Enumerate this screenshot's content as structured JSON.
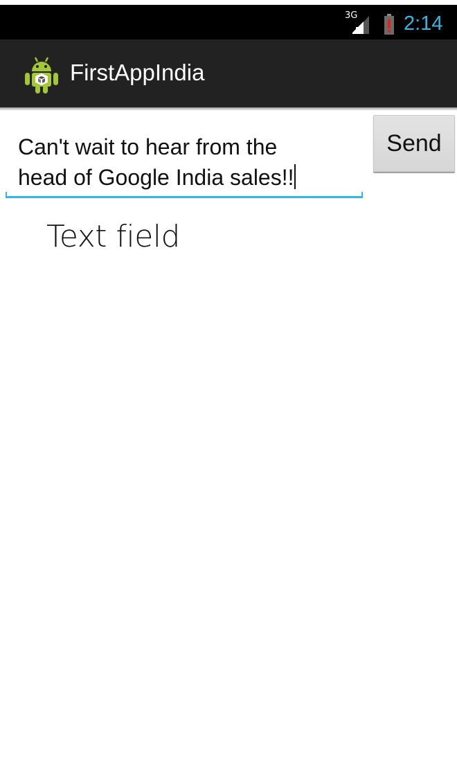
{
  "status_bar": {
    "network_type": "3G",
    "time": "2:14",
    "clock_color": "#33b5e5",
    "icons": [
      "signal-icon",
      "battery-low-icon"
    ]
  },
  "action_bar": {
    "icon": "android-app-icon",
    "title": "FirstAppIndia",
    "background": "#222222"
  },
  "compose": {
    "message_line_1": "Can't wait to hear from the",
    "message_line_2": "head of Google India sales!!",
    "underline_color": "#33b5e5",
    "send_label": "Send"
  },
  "annotation": {
    "label": "Text field"
  }
}
